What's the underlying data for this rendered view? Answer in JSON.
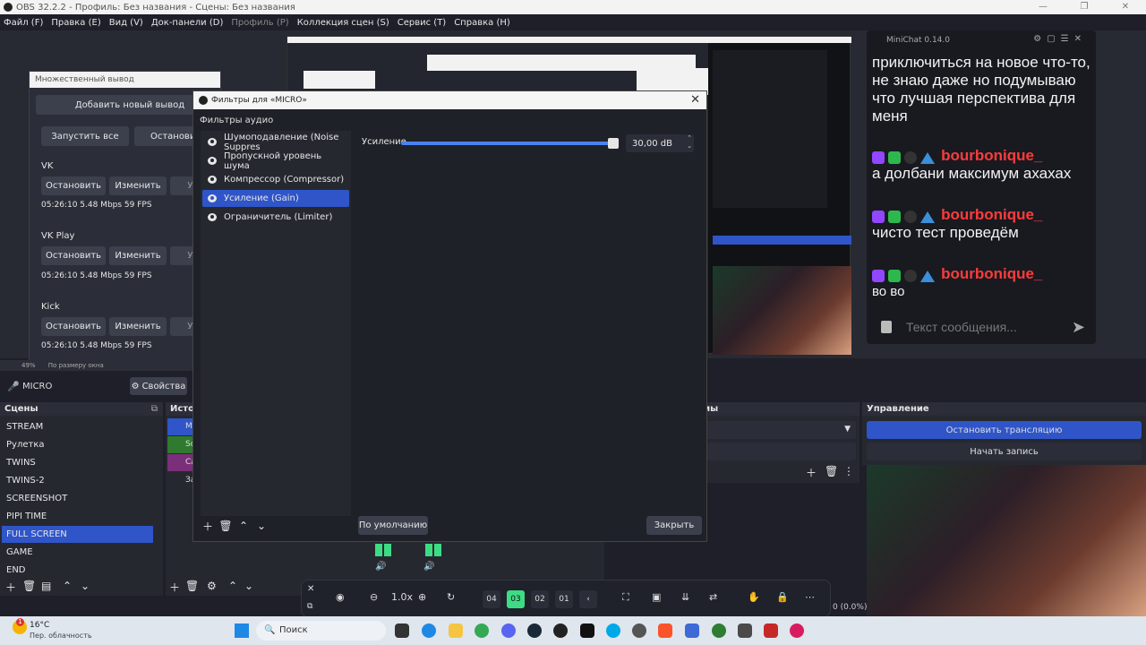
{
  "window": {
    "title": "OBS 32.2.2 - Профиль: Без названия - Сцены: Без названия",
    "controls": [
      "—",
      "❐",
      "✕"
    ]
  },
  "menu": {
    "items": [
      {
        "label": "Файл (F)",
        "disabled": false
      },
      {
        "label": "Правка (E)",
        "disabled": false
      },
      {
        "label": "Вид (V)",
        "disabled": false
      },
      {
        "label": "Док-панели (D)",
        "disabled": false
      },
      {
        "label": "Профиль (P)",
        "disabled": true
      },
      {
        "label": "Коллекция сцен (S)",
        "disabled": false
      },
      {
        "label": "Сервис (T)",
        "disabled": false
      },
      {
        "label": "Справка (H)",
        "disabled": false
      }
    ]
  },
  "chat": {
    "title": "MiniChat 0.14.0",
    "messages": [
      {
        "user": "",
        "text": "приключиться на новое что-то, не знаю даже но подумываю что лучшая перспектива для меня"
      },
      {
        "user": "bourbonique_",
        "text": "а долбани максимум ахахах"
      },
      {
        "user": "bourbonique_",
        "text": "чисто тест проведём"
      },
      {
        "user": "bourbonique_",
        "text": "во во"
      }
    ],
    "input_placeholder": "Текст сообщения..."
  },
  "multi_output": {
    "title": "Множественный вывод",
    "add_button": "Добавить новый вывод",
    "start_all": "Запустить все",
    "stop_all": "Остановить",
    "outputs": [
      {
        "name": "VK",
        "stop": "Остановить",
        "edit": "Изменить",
        "remove": "Уда",
        "stats": "05:26:10  5.48 Mbps  59 FPS"
      },
      {
        "name": "VK Play",
        "stop": "Остановить",
        "edit": "Изменить",
        "remove": "Уда",
        "stats": "05:26:10  5.48 Mbps  59 FPS"
      },
      {
        "name": "Kick",
        "stop": "Остановить",
        "edit": "Изменить",
        "remove": "Уда",
        "stats": "05:26:10  5.48 Mbps  59 FPS"
      }
    ]
  },
  "preview_status": {
    "zoom": "49%",
    "fit": "По размеру окна"
  },
  "source_bar": {
    "source": "MICRO",
    "properties": "Свойства"
  },
  "filters": {
    "title": "Фильтры для «MICRO»",
    "section": "Фильтры аудио",
    "items": [
      {
        "label": "Шумоподавление (Noise Suppres",
        "selected": false
      },
      {
        "label": "Пропускной уровень шума",
        "selected": false
      },
      {
        "label": "Компрессор (Compressor)",
        "selected": false
      },
      {
        "label": "Усиление (Gain)",
        "selected": true
      },
      {
        "label": "Ограничитель (Limiter)",
        "selected": false
      }
    ],
    "gain": {
      "label": "Усиление",
      "value_text": "30,00 dB",
      "fraction": 1.0
    },
    "defaults_button": "По умолчанию",
    "close_button": "Закрыть"
  },
  "scenes": {
    "header": "Сцены",
    "items": [
      {
        "label": "STREAM",
        "selected": false
      },
      {
        "label": "Рулетка",
        "selected": false
      },
      {
        "label": "TWINS",
        "selected": false
      },
      {
        "label": "TWINS-2",
        "selected": false
      },
      {
        "label": "SCREENSHOT",
        "selected": false
      },
      {
        "label": "PIPI TIME",
        "selected": false
      },
      {
        "label": "FULL SCREEN",
        "selected": true
      },
      {
        "label": "GAME",
        "selected": false
      },
      {
        "label": "END",
        "selected": false
      }
    ]
  },
  "sources": {
    "header": "Источ",
    "items": [
      "MI",
      "So",
      "Ca",
      "За"
    ]
  },
  "transitions": {
    "header": "мы"
  },
  "controls": {
    "header": "Управление",
    "stop_stream": "Остановить трансляцию",
    "start_record": "Начать запись"
  },
  "zoombar": {
    "zoom": "1.0x",
    "pages": [
      "04",
      "03",
      "02",
      "01"
    ],
    "active_page": "03"
  },
  "status_right": "0 (0.0%)",
  "taskbar": {
    "weather_temp": "16°C",
    "weather_desc": "Пер. облачность",
    "weather_badge": "1",
    "search": "Поиск"
  },
  "colors": {
    "accent": "#2f55c8",
    "chat_user": "#ff3b3b",
    "active_page": "#3ddc84"
  }
}
